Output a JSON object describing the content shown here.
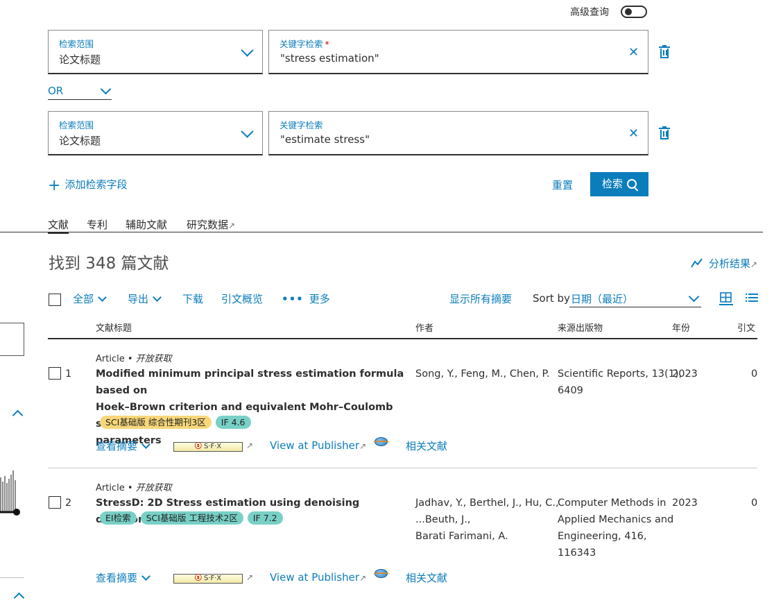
{
  "advanced": {
    "label": "高级查询"
  },
  "fields": [
    {
      "scope_label": "检索范围",
      "scope_value": "论文标题",
      "keyword_label": "关键字检索",
      "required_mark": "*",
      "keyword_value": "\"stress estimation\""
    },
    {
      "scope_label": "检索范围",
      "scope_value": "论文标题",
      "keyword_label": "关键字检索",
      "keyword_value": "\"estimate stress\""
    }
  ],
  "boolean_operator": "OR",
  "actions": {
    "add_field": "添加检索字段",
    "reset": "重置",
    "search": "检索"
  },
  "tabs": [
    "文献",
    "专利",
    "辅助文献",
    "研究数据"
  ],
  "results": {
    "summary": "找到 348 篇文献",
    "analyze": "分析结果"
  },
  "toolbar": {
    "all": "全部",
    "export": "导出",
    "download": "下载",
    "citation_overview": "引文概览",
    "more": "更多",
    "show_abstracts": "显示所有摘要",
    "sort_by": "Sort by",
    "sort_value": "日期（最近）"
  },
  "columns": {
    "title": "文献标题",
    "authors": "作者",
    "source": "来源出版物",
    "year": "年份",
    "citations": "引文"
  },
  "records": [
    {
      "index": "1",
      "type": "Article",
      "access": "开放获取",
      "title_lines": [
        "Modified minimum principal stress estimation formula based on",
        "Hoek–Brown criterion and equivalent Mohr–Coulomb strength",
        "parameters"
      ],
      "badges": [
        "SCI基础版 综合性期刊3区",
        "IF 4.6"
      ],
      "authors_lines": [
        "Song, Y., Feng, M., Chen, P."
      ],
      "source_lines": [
        "Scientific Reports, 13(1),",
        "6409"
      ],
      "year": "2023",
      "citations": "0"
    },
    {
      "index": "2",
      "type": "Article",
      "access": "开放获取",
      "title_lines": [
        "StressD: 2D Stress estimation using denoising diffusion model"
      ],
      "badges": [
        "EI检索",
        "SCI基础版 工程技术2区",
        "IF 7.2"
      ],
      "authors_lines": [
        "Jadhav, Y., Berthel, J., Hu, C.,",
        "...Beuth, J.,",
        "Barati Farimani, A."
      ],
      "source_lines": [
        "Computer Methods in",
        "Applied Mechanics and",
        "Engineering, 416,",
        "116343"
      ],
      "year": "2023",
      "citations": "0"
    }
  ],
  "record_links": {
    "view_abstract": "查看摘要",
    "sfx": "S·F·X",
    "publisher": "View at Publisher",
    "related": "相关文献"
  },
  "dot": "•",
  "ext_arrow": "↗",
  "colors": {
    "accent": "#0c7dbb",
    "badge_yellow": "#f7d77a",
    "badge_teal": "#78d0c6"
  }
}
